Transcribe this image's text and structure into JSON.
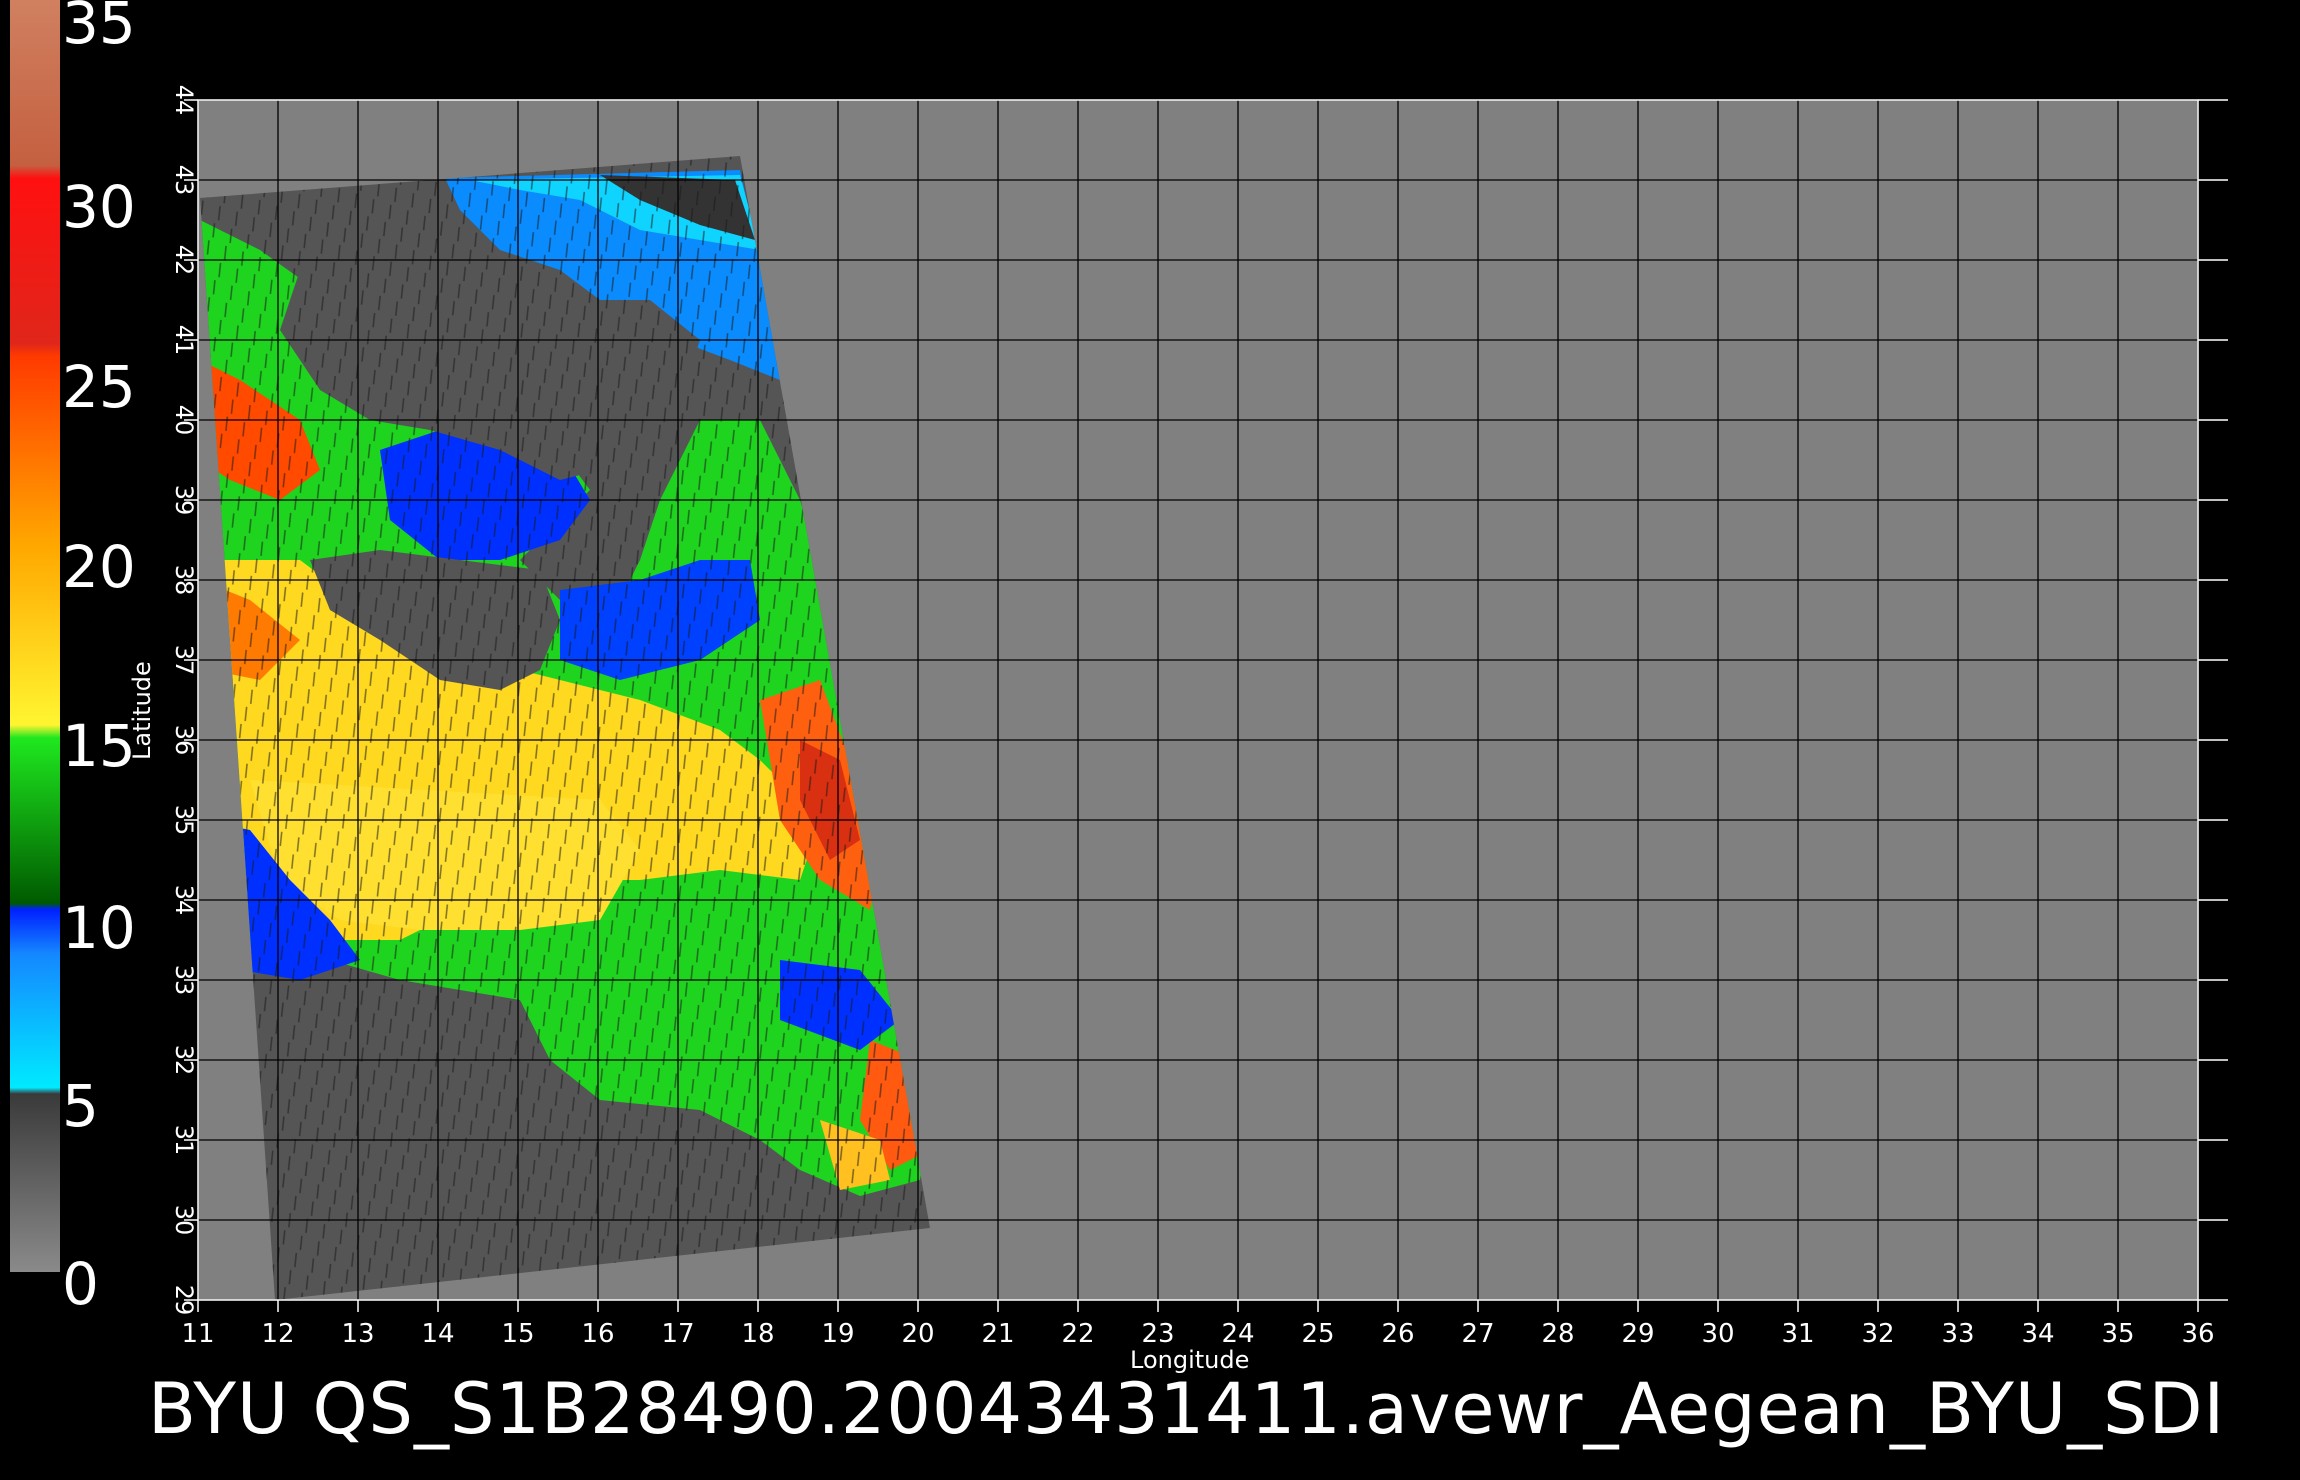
{
  "colorbar": {
    "ticks": [
      "0",
      "5",
      "10",
      "15",
      "20",
      "25",
      "30",
      "35"
    ],
    "stops": [
      "#4a4a4a",
      "#888888",
      "#00e5ff",
      "#1f6cff",
      "#0030ff",
      "#006b00",
      "#1bd91b",
      "#fff230",
      "#ffc000",
      "#ff8a00",
      "#ff3a00",
      "#c01810",
      "#ff1a1a",
      "#c87050"
    ]
  },
  "map": {
    "x_ticks": [
      "11",
      "12",
      "13",
      "14",
      "15",
      "16",
      "17",
      "18",
      "19",
      "20",
      "21",
      "22",
      "23",
      "24",
      "25",
      "26",
      "27",
      "28",
      "29",
      "30",
      "31",
      "32",
      "33",
      "34",
      "35",
      "36"
    ],
    "y_ticks": [
      "29",
      "30",
      "31",
      "32",
      "33",
      "34",
      "35",
      "36",
      "37",
      "38",
      "39",
      "40",
      "41",
      "42",
      "43",
      "44"
    ],
    "x_title": "Longitude",
    "y_title": "Latitude",
    "background": "#808080",
    "land_color": "#555555"
  },
  "caption": "BYU  QS_S1B28490.20043431411.avewr_Aegean_BYU_SDI"
}
